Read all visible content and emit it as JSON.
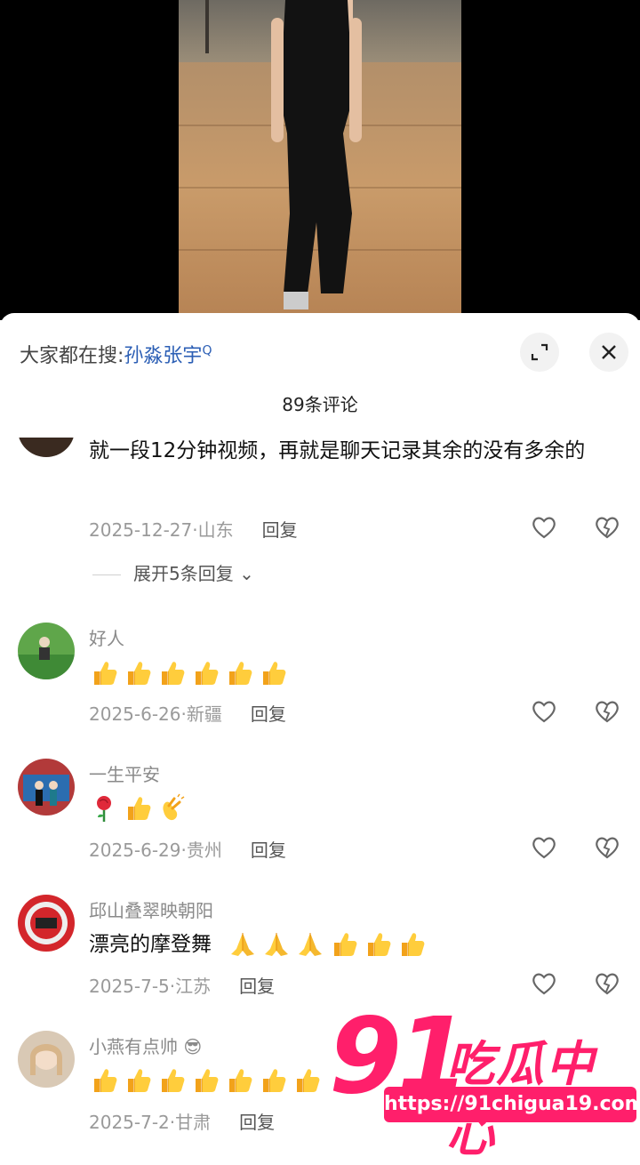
{
  "search": {
    "prefix": "大家都在搜:",
    "term": "孙淼张宇"
  },
  "comments_header": "89条评论",
  "comments": [
    {
      "name": "",
      "text": "就一段12分钟视频，再就是聊天记录其余的没有多余的",
      "date": "2025-12-27·山东",
      "reply": "回复",
      "expand": "展开5条回复"
    },
    {
      "name": "好人",
      "emoji": [
        "thumb",
        "thumb",
        "thumb",
        "thumb",
        "thumb",
        "thumb"
      ],
      "date": "2025-6-26·新疆",
      "reply": "回复"
    },
    {
      "name": "一生平安",
      "emoji": [
        "rose",
        "thumb",
        "clap"
      ],
      "date": "2025-6-29·贵州",
      "reply": "回复"
    },
    {
      "name": "邱山叠翠映朝阳",
      "text": "漂亮的摩登舞",
      "emoji": [
        "pray",
        "pray",
        "pray",
        "thumb",
        "thumb",
        "thumb"
      ],
      "date": "2025-7-5·江苏",
      "reply": "回复"
    },
    {
      "name": "小燕有点帅",
      "emoji": [
        "thumb",
        "thumb",
        "thumb",
        "thumb",
        "thumb",
        "thumb",
        "thumb"
      ],
      "date": "2025-7-2·甘肃",
      "reply": "回复"
    }
  ],
  "watermark": {
    "big": "91",
    "cn": "吃瓜中心",
    "url": "https://91chigua19.com"
  },
  "colors": {
    "accent": "#ff1f6b",
    "link": "#2c5fb5"
  }
}
